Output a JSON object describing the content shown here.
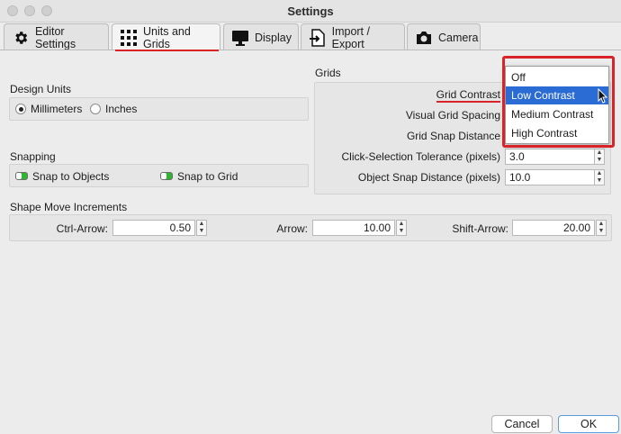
{
  "window": {
    "title": "Settings"
  },
  "tabs": [
    {
      "label": "Editor Settings",
      "icon": "gear-icon"
    },
    {
      "label": "Units and Grids",
      "icon": "grid-icon",
      "active": true
    },
    {
      "label": "Display",
      "icon": "monitor-icon"
    },
    {
      "label": "Import / Export",
      "icon": "import-export-icon"
    },
    {
      "label": "Camera",
      "icon": "camera-icon"
    }
  ],
  "design_units": {
    "title": "Design Units",
    "options": [
      {
        "label": "Millimeters",
        "checked": true
      },
      {
        "label": "Inches",
        "checked": false
      }
    ]
  },
  "snapping": {
    "title": "Snapping",
    "options": [
      {
        "label": "Snap to Objects",
        "on": true
      },
      {
        "label": "Snap to Grid",
        "on": true
      }
    ]
  },
  "grids": {
    "title": "Grids",
    "rows": [
      {
        "label": "Grid Contrast"
      },
      {
        "label": "Visual Grid Spacing"
      },
      {
        "label": "Grid Snap Distance"
      },
      {
        "label": "Click-Selection Tolerance (pixels)",
        "value": "3.0"
      },
      {
        "label": "Object Snap Distance (pixels)",
        "value": "10.0"
      }
    ],
    "contrast_options": [
      "Off",
      "Low Contrast",
      "Medium Contrast",
      "High Contrast"
    ],
    "contrast_selected": "Low Contrast"
  },
  "shape_move": {
    "title": "Shape Move Increments",
    "fields": [
      {
        "label": "Ctrl-Arrow:",
        "value": "0.50"
      },
      {
        "label": "Arrow:",
        "value": "10.00"
      },
      {
        "label": "Shift-Arrow:",
        "value": "20.00"
      }
    ]
  },
  "buttons": {
    "cancel": "Cancel",
    "ok": "OK"
  },
  "colors": {
    "accent": "#2a6cd3",
    "highlight": "#d8232a",
    "toggle": "#2fb52f"
  }
}
